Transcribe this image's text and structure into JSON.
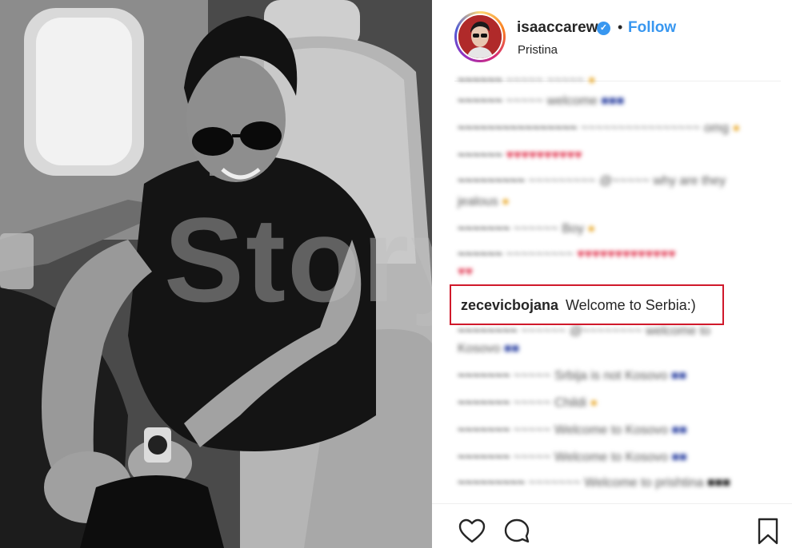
{
  "post": {
    "username": "isaaccarew",
    "verified_icon": "verified-check-icon",
    "separator": "•",
    "follow_label": "Follow",
    "location": "Pristina"
  },
  "watermark": {
    "text": "Story.al"
  },
  "highlighted_comment": {
    "username": "zecevicbojana",
    "text": "Welcome to Serbia:)"
  },
  "blurred_comments": [
    {
      "user": "",
      "text": "~~~~~ ~~~~~"
    },
    {
      "user": "",
      "text": "~~~~~ welcome"
    },
    {
      "user": "",
      "text": "~~~~~~~~~~~~~~~~ omg"
    },
    {
      "user": "",
      "text": "~~~~~"
    },
    {
      "user": "",
      "text": "~~~~~~~~~ @~~~~~ why are they"
    },
    {
      "user": "",
      "text": "jealous"
    },
    {
      "user": "",
      "text": "~~~~~~ Boy"
    },
    {
      "user": "",
      "text": "~~~~~~ ~~~~~~~"
    },
    {
      "user": "",
      "text": "~~~~~~ @~~~~~~~~ welcome to"
    },
    {
      "user": "",
      "text": "Kosovo"
    },
    {
      "user": "",
      "text": "~~~~~ Srbija is not Kosovo"
    },
    {
      "user": "",
      "text": "~~~~~ Childi"
    },
    {
      "user": "",
      "text": "~~~~~ Welcome to Kosovo"
    },
    {
      "user": "",
      "text": "~~~~~ Welcome to Kosovo"
    },
    {
      "user": "",
      "text": "~~~~~~~ Welcome to prishtina"
    }
  ],
  "actions": {
    "like_icon": "heart-icon",
    "comment_icon": "comment-icon",
    "save_icon": "bookmark-icon"
  },
  "colors": {
    "link_blue": "#3897f0",
    "highlight_border": "#d0192b",
    "text": "#262626"
  }
}
